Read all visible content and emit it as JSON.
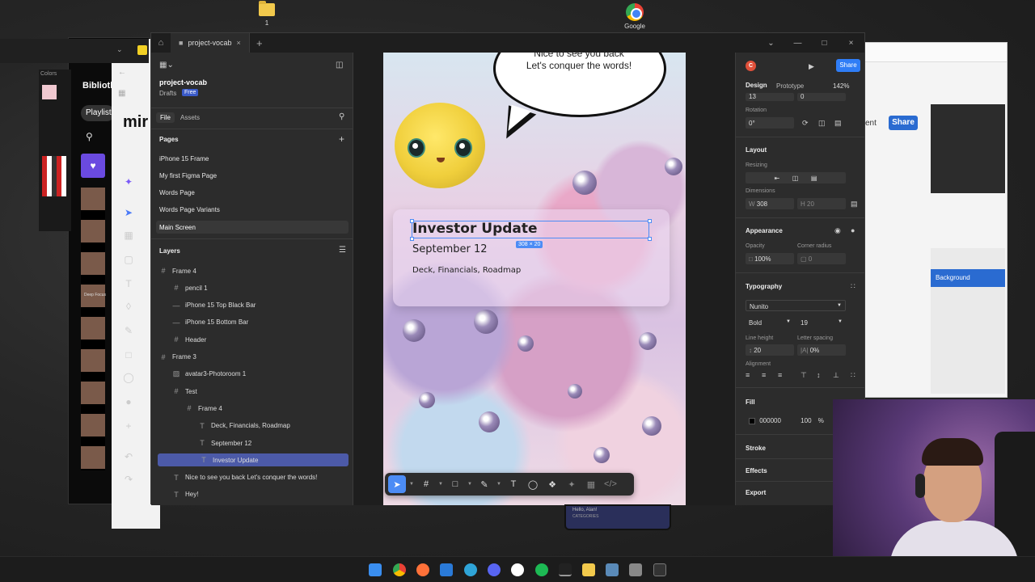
{
  "desktop": {
    "folder_label": "1",
    "chrome_label": "Google"
  },
  "background_windows": {
    "colors_label": "Colors",
    "bibliotheque_label": "Biblioth",
    "playlist_label": "Playlist",
    "miro_label": "mir",
    "deep_focus_label": "Deep Focus",
    "right_share_label": "Share",
    "right_ent_label": "ent",
    "right_background_label": "Background"
  },
  "titlebar": {
    "tab_label": "project-vocab"
  },
  "left_panel": {
    "project_name": "project-vocab",
    "drafts_label": "Drafts",
    "free_badge": "Free",
    "tabs": [
      "File",
      "Assets"
    ],
    "pages_header": "Pages",
    "pages": [
      "iPhone 15 Frame",
      "My first Figma Page",
      "Words Page",
      "Words Page Variants",
      "Main Screen"
    ],
    "layers_header": "Layers",
    "layers": [
      {
        "label": "Frame 4",
        "icon": "#",
        "indent": 0
      },
      {
        "label": "pencil 1",
        "icon": "#",
        "indent": 1
      },
      {
        "label": "iPhone 15 Top Black Bar",
        "icon": "―",
        "indent": 1
      },
      {
        "label": "iPhone 15 Bottom Bar",
        "icon": "―",
        "indent": 1
      },
      {
        "label": "Header",
        "icon": "#",
        "indent": 1
      },
      {
        "label": "Frame 3",
        "icon": "#",
        "indent": 0
      },
      {
        "label": "avatar3-Photoroom 1",
        "icon": "▨",
        "indent": 1
      },
      {
        "label": "Test",
        "icon": "#",
        "indent": 1
      },
      {
        "label": "Frame 4",
        "icon": "#",
        "indent": 2
      },
      {
        "label": "Deck, Financials, Roadmap",
        "icon": "T",
        "indent": 3
      },
      {
        "label": "September 12",
        "icon": "T",
        "indent": 3
      },
      {
        "label": "Investor Update",
        "icon": "T",
        "indent": 3
      },
      {
        "label": "Nice to see you back Let's conquer the words!",
        "icon": "T",
        "indent": 1
      },
      {
        "label": "Hey!",
        "icon": "T",
        "indent": 1
      }
    ]
  },
  "canvas": {
    "bubble_line1": "Nice to see you back",
    "bubble_line2": "Let's conquer the words!",
    "card_title": "Investor Update",
    "card_date": "September 12",
    "card_sub": "Deck, Financials, Roadmap",
    "dimension_tag": "308 × 20",
    "bottom_preview_text": "Hello, Alan!",
    "bottom_preview_sub": "CATEGORIES"
  },
  "right_panel": {
    "avatar_letter": "C",
    "share_label": "Share",
    "tabs": [
      "Design",
      "Prototype"
    ],
    "zoom": "142%",
    "rotation_label": "Rotation",
    "rotation_value": "0°",
    "x_value": "13",
    "y_value": "0",
    "layout_header": "Layout",
    "resizing_label": "Resizing",
    "dimensions_label": "Dimensions",
    "w_value": "308",
    "h_value": "20",
    "appearance_header": "Appearance",
    "opacity_label": "Opacity",
    "opacity_value": "100%",
    "corner_label": "Corner radius",
    "corner_value": "0",
    "typography_header": "Typography",
    "font_family": "Nunito",
    "font_weight": "Bold",
    "font_size": "19",
    "line_height_label": "Line height",
    "line_height_value": "20",
    "letter_spacing_label": "Letter spacing",
    "letter_spacing_value": "0%",
    "alignment_label": "Alignment",
    "fill_header": "Fill",
    "fill_hex": "000000",
    "fill_opacity": "100",
    "fill_pct": "%",
    "stroke_header": "Stroke",
    "effects_header": "Effects",
    "export_header": "Export"
  },
  "colors": {
    "figma_bg": "#2c2c2c",
    "selection_blue": "#4c8cf5",
    "layer_selected": "#4c5aa8",
    "share_blue": "#2f7df6"
  }
}
